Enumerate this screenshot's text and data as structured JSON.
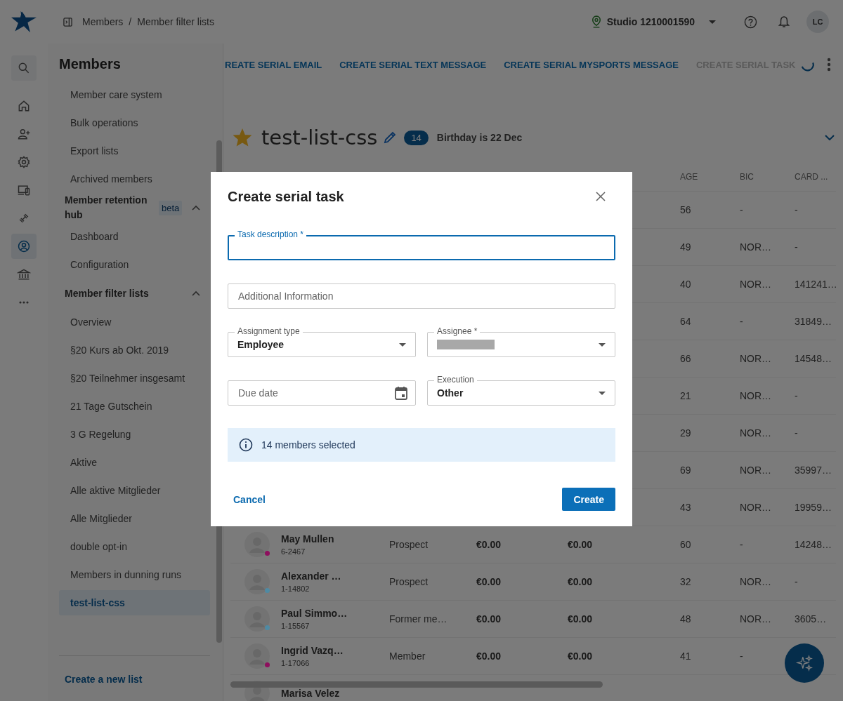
{
  "header": {
    "breadcrumb": [
      "Members",
      "Member filter lists"
    ],
    "separator": "/",
    "location": "Studio 1210001590",
    "user_initials": "LC"
  },
  "rail": [
    {
      "selected": false
    },
    {
      "selected": false
    },
    {
      "selected": false
    },
    {
      "selected": false
    },
    {
      "selected": false
    },
    {
      "selected": false
    },
    {
      "selected": true
    },
    {
      "selected": false
    },
    {
      "selected": false
    }
  ],
  "sidebar": {
    "title": "Members",
    "items": [
      {
        "kind": "link",
        "label": "Member care system",
        "selected": false
      },
      {
        "kind": "link",
        "label": "Bulk operations",
        "selected": false
      },
      {
        "kind": "link",
        "label": "Export lists",
        "selected": false
      },
      {
        "kind": "link",
        "label": "Archived members",
        "selected": false
      },
      {
        "kind": "group",
        "label": "Member retention hub",
        "badge": "beta",
        "expanded": true,
        "children": [
          {
            "label": "Dashboard",
            "selected": false
          },
          {
            "label": "Configuration",
            "selected": false
          }
        ]
      },
      {
        "kind": "group",
        "label": "Member filter lists",
        "expanded": true,
        "children": [
          {
            "label": "Overview",
            "selected": false
          },
          {
            "label": "§20 Kurs ab Okt. 2019",
            "selected": false
          },
          {
            "label": "§20 Teilnehmer insgesamt",
            "selected": false
          },
          {
            "label": "21 Tage Gutschein",
            "selected": false
          },
          {
            "label": "3 G Regelung",
            "selected": false
          },
          {
            "label": "Aktive",
            "selected": false
          },
          {
            "label": "Alle aktive Mitglieder",
            "selected": false
          },
          {
            "label": "Alle Mitglieder",
            "selected": false
          },
          {
            "label": "double opt-in",
            "selected": false
          },
          {
            "label": "Members in dunning runs",
            "selected": false
          },
          {
            "label": "test-list-css",
            "selected": true
          }
        ]
      }
    ],
    "footer_link": "Create a new list"
  },
  "actions": [
    {
      "label": "REATE SERIAL EMAIL",
      "disabled": false,
      "loading": false
    },
    {
      "label": "CREATE SERIAL TEXT MESSAGE",
      "disabled": false,
      "loading": false
    },
    {
      "label": "CREATE SERIAL MYSPORTS MESSAGE",
      "disabled": false,
      "loading": false
    },
    {
      "label": "CREATE SERIAL TASK",
      "disabled": true,
      "loading": true
    }
  ],
  "list": {
    "starred": true,
    "title": "test-list-css",
    "count": "14",
    "filter": "Birthday is 22 Dec"
  },
  "table": {
    "columns": [
      "AGE",
      "BIC",
      "CARD ..."
    ],
    "rows": [
      {
        "age": "56",
        "bic": "-",
        "card": "-"
      },
      {
        "age": "49",
        "bic": "NOR…",
        "card": "-"
      },
      {
        "age": "40",
        "bic": "NOR…",
        "card": "141241…"
      },
      {
        "age": "64",
        "bic": "-",
        "card": "31849…"
      },
      {
        "age": "66",
        "bic": "NOR…",
        "card": "14548…"
      },
      {
        "age": "21",
        "bic": "NOR…",
        "card": "-"
      },
      {
        "age": "29",
        "bic": "NOR…",
        "card": "-"
      },
      {
        "age": "69",
        "bic": "NOR…",
        "card": "35997…"
      },
      {
        "age": "43",
        "bic": "NOR…",
        "card": "19959…"
      },
      {
        "name": "May Mullen",
        "number": "6-2467",
        "color": "#8e0f5e",
        "type": "Prospect",
        "account": "€0.00",
        "consumption": "€0.00",
        "age": "60",
        "bic": "-",
        "card": "14248…"
      },
      {
        "name": "Alexander …",
        "number": "1-14802",
        "color": "#4f8aa3",
        "type": "Prospect",
        "account": "€0.00",
        "consumption": "€0.00",
        "age": "32",
        "bic": "NOR…",
        "card": "-"
      },
      {
        "name": "Paul Simmo…",
        "number": "1-15567",
        "color": "#4f8aa3",
        "type": "Former me…",
        "account": "€0.00",
        "consumption": "€0.00",
        "age": "48",
        "bic": "NOR…",
        "card": "3605…"
      },
      {
        "name": "Ingrid Vazq…",
        "number": "1-17066",
        "color": "#8e0f5e",
        "type": "Member",
        "account": "€0.00",
        "consumption": "€0.00",
        "age": "41",
        "bic": "-"
      },
      {
        "name": "Marisa Velez"
      }
    ]
  },
  "modal": {
    "title": "Create serial task",
    "rows": [
      {
        "fields": [
          {
            "kind": "text",
            "label": "Task description *",
            "focused": true
          }
        ]
      },
      {
        "fields": [
          {
            "kind": "text",
            "placeholder": "Additional Information",
            "focused": false
          }
        ]
      },
      {
        "fields": [
          {
            "kind": "select",
            "label": "Assignment type",
            "value": "Employee",
            "redacted": false,
            "focused": false
          },
          {
            "kind": "select",
            "label": "Assignee *",
            "redacted": true,
            "focused": false
          }
        ]
      },
      {
        "fields": [
          {
            "kind": "date",
            "placeholder": "Due date",
            "focused": false
          },
          {
            "kind": "select",
            "label": "Execution",
            "value": "Other",
            "redacted": false,
            "focused": false
          }
        ]
      }
    ],
    "info": "14 members selected",
    "cancel": "Cancel",
    "submit": "Create"
  }
}
